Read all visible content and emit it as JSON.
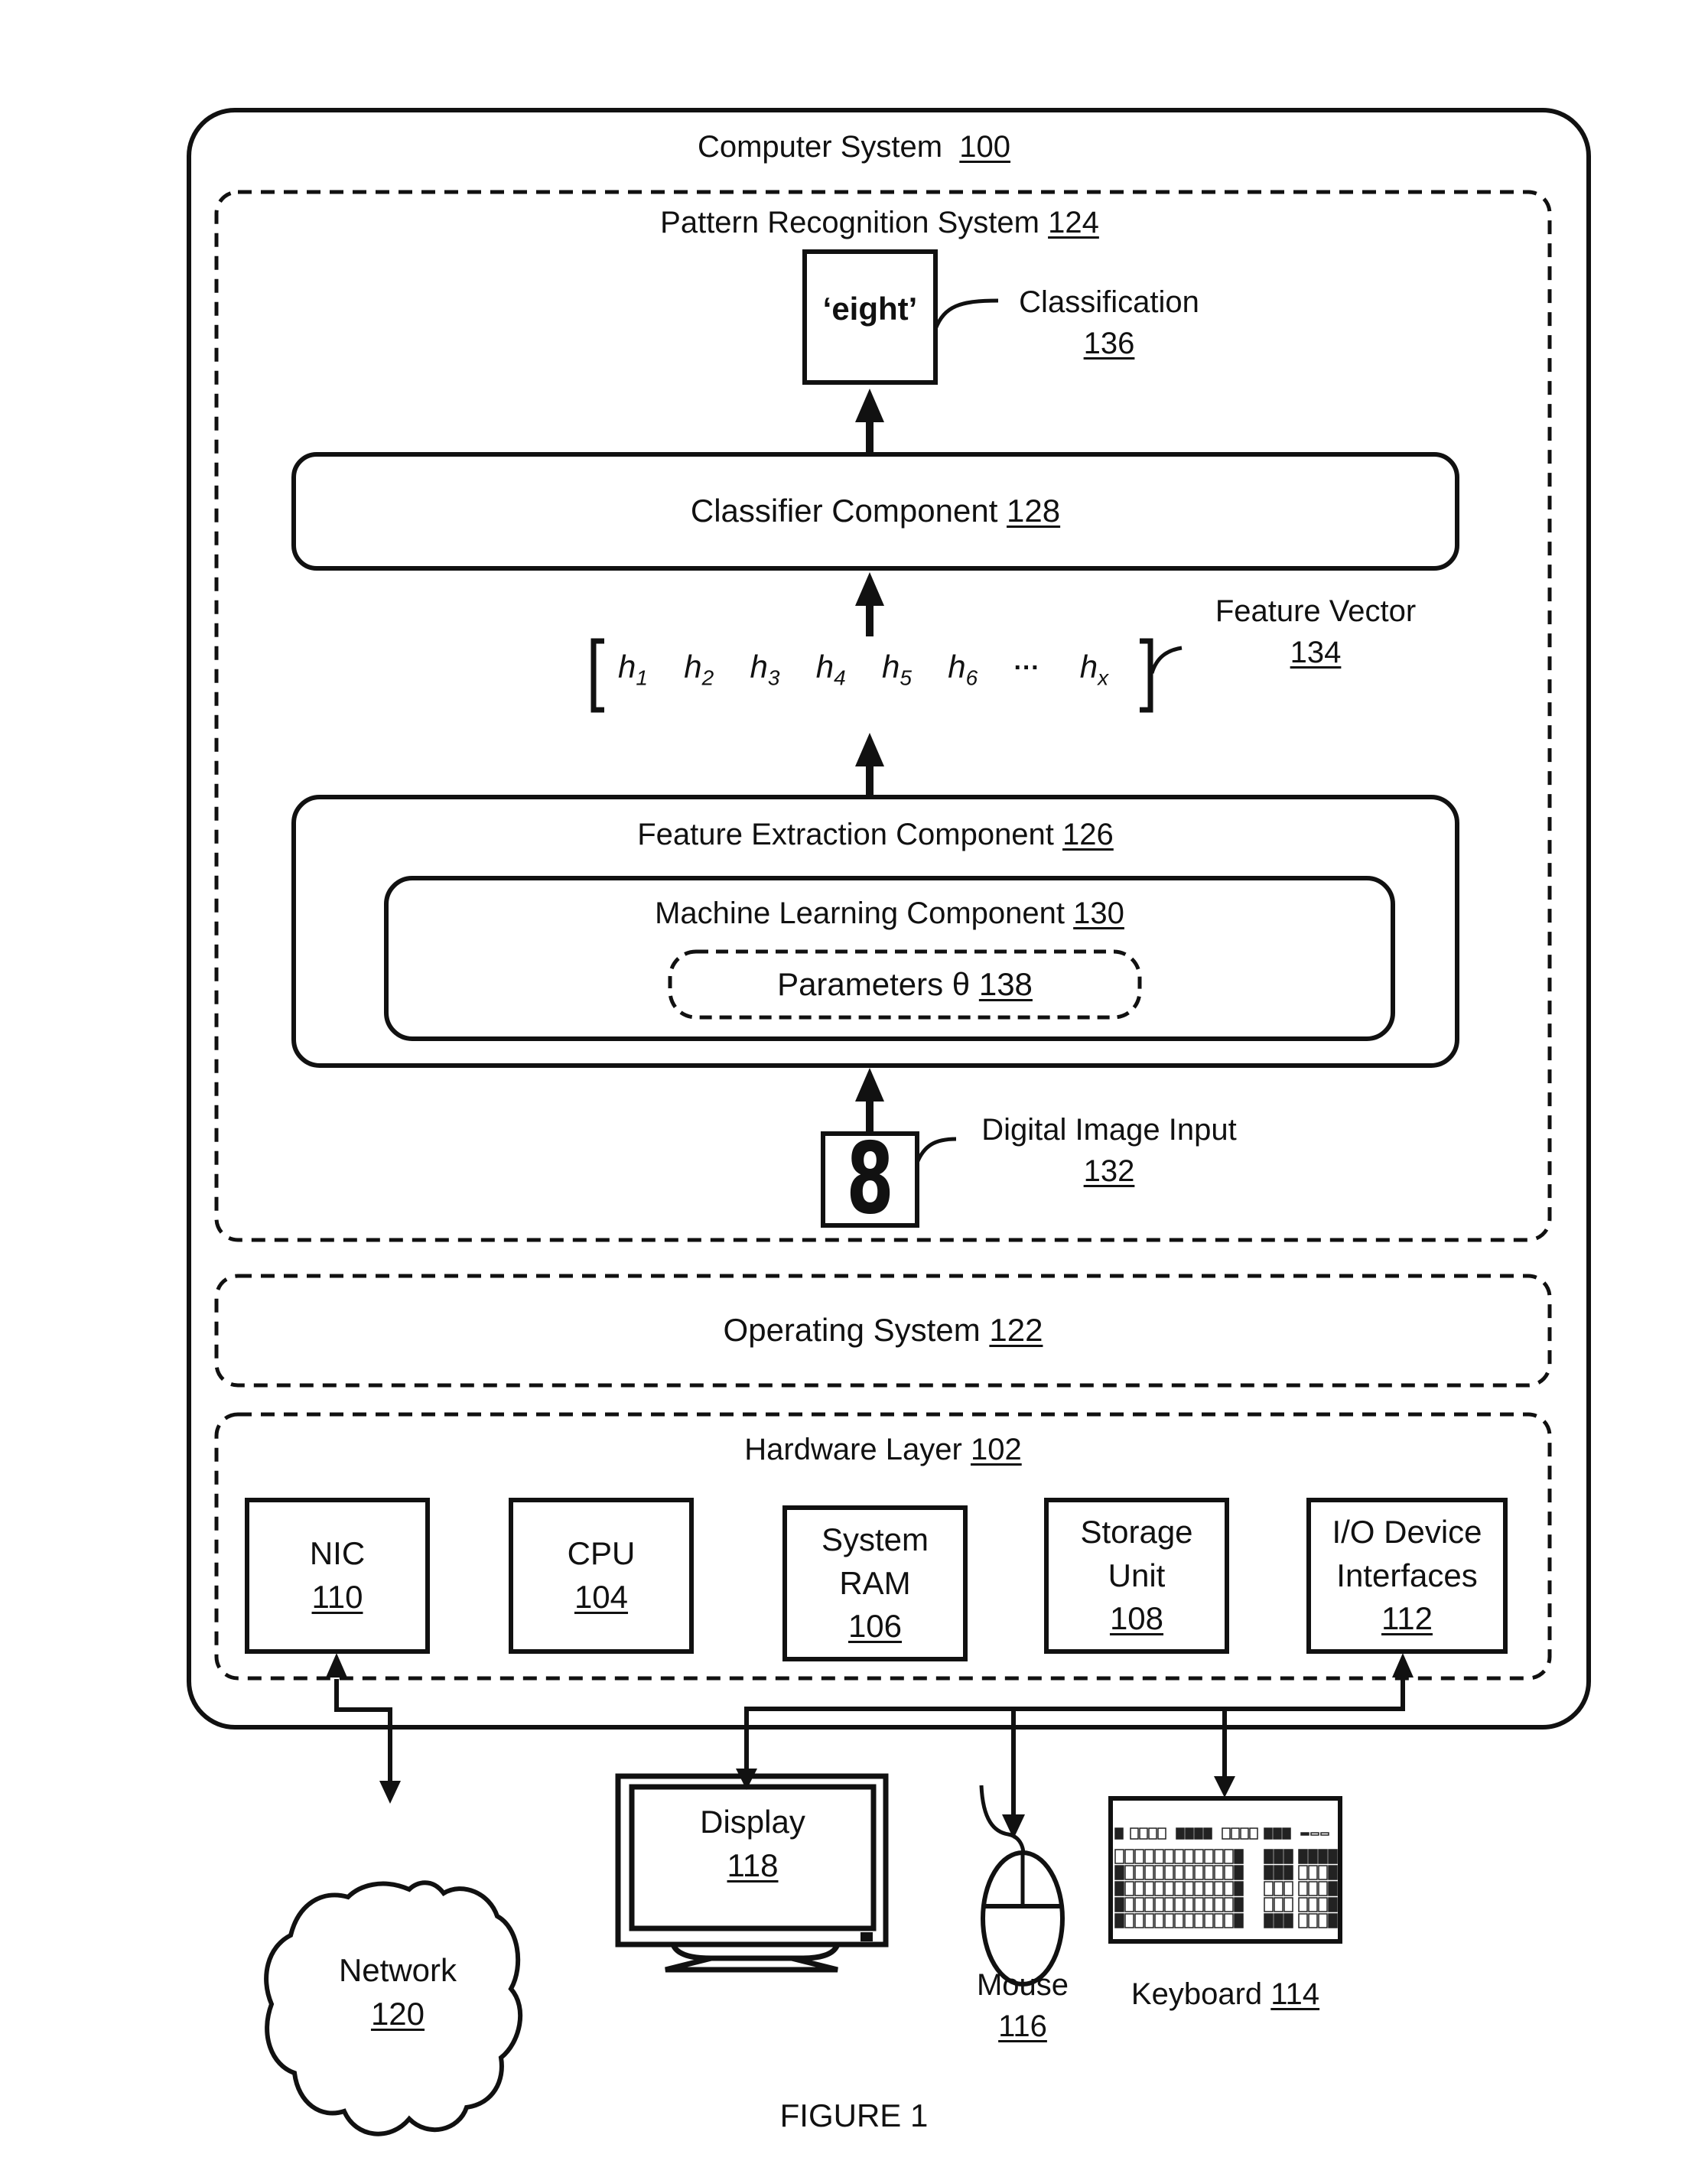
{
  "computer_system": {
    "label": "Computer System",
    "ref": "100"
  },
  "pattern_recognition": {
    "label": "Pattern Recognition System",
    "ref": "124"
  },
  "classification": {
    "output_text": "‘eight’",
    "label": "Classification",
    "ref": "136"
  },
  "classifier": {
    "label": "Classifier Component",
    "ref": "128"
  },
  "feature_vector": {
    "label": "Feature Vector",
    "ref": "134",
    "elements": [
      {
        "base": "h",
        "sub": "1"
      },
      {
        "base": "h",
        "sub": "2"
      },
      {
        "base": "h",
        "sub": "3"
      },
      {
        "base": "h",
        "sub": "4"
      },
      {
        "base": "h",
        "sub": "5"
      },
      {
        "base": "h",
        "sub": "6"
      },
      {
        "base": "···",
        "sub": ""
      },
      {
        "base": "h",
        "sub": "x"
      }
    ]
  },
  "feature_extraction": {
    "label": "Feature Extraction Component",
    "ref": "126"
  },
  "machine_learning": {
    "label": "Machine Learning Component",
    "ref": "130"
  },
  "parameters": {
    "label": "Parameters θ",
    "ref": "138"
  },
  "digital_image": {
    "glyph": "8",
    "label": "Digital Image Input",
    "ref": "132"
  },
  "operating_system": {
    "label": "Operating System",
    "ref": "122"
  },
  "hardware_layer": {
    "label": "Hardware Layer",
    "ref": "102",
    "components": [
      {
        "lines": [
          "NIC"
        ],
        "ref": "110"
      },
      {
        "lines": [
          "CPU"
        ],
        "ref": "104"
      },
      {
        "lines": [
          "System",
          "RAM"
        ],
        "ref": "106"
      },
      {
        "lines": [
          "Storage",
          "Unit"
        ],
        "ref": "108"
      },
      {
        "lines": [
          "I/O Device",
          "Interfaces"
        ],
        "ref": "112"
      }
    ]
  },
  "peripherals": {
    "network": {
      "label": "Network",
      "ref": "120"
    },
    "display": {
      "label": "Display",
      "ref": "118"
    },
    "mouse": {
      "label": "Mouse",
      "ref": "116"
    },
    "keyboard": {
      "label": "Keyboard",
      "ref": "114"
    }
  },
  "caption": "FIGURE 1"
}
